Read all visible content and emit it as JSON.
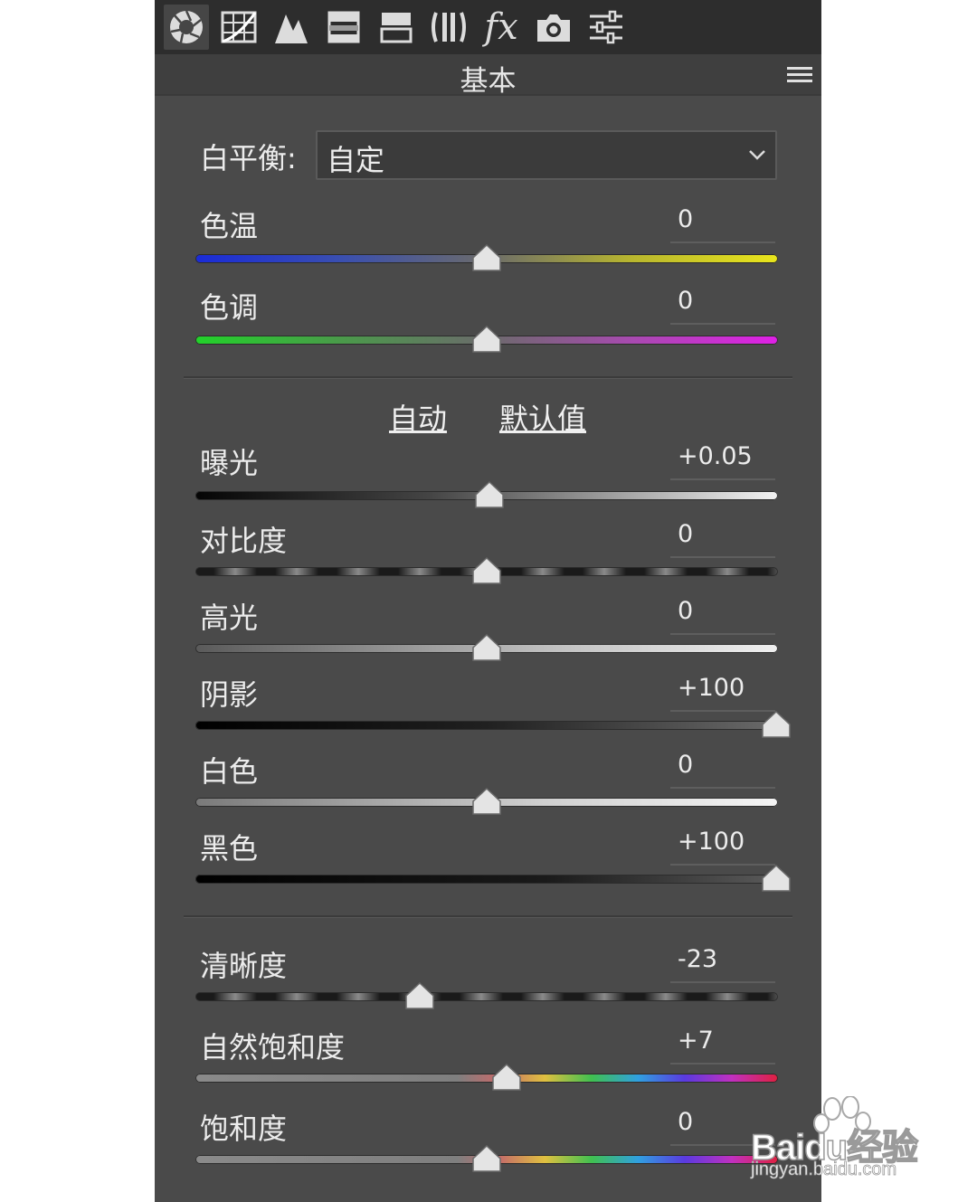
{
  "toolbar": {
    "icons": [
      "aperture-icon",
      "tone-curve-icon",
      "detail-icon",
      "hsl-icon",
      "split-toning-icon",
      "lens-corrections-icon",
      "fx-effects-icon",
      "camera-calibration-icon",
      "presets-sliders-icon"
    ],
    "fx_label": "fx"
  },
  "panel": {
    "title": "基本"
  },
  "white_balance": {
    "label": "白平衡:",
    "value": "自定"
  },
  "links": {
    "auto": "自动",
    "default": "默认值"
  },
  "sliders": [
    {
      "id": "temperature",
      "label": "色温",
      "value": "0",
      "fraction": 0.5
    },
    {
      "id": "tint",
      "label": "色调",
      "value": "0",
      "fraction": 0.5
    },
    {
      "id": "exposure",
      "label": "曝光",
      "value": "+0.05",
      "fraction": 0.505
    },
    {
      "id": "contrast",
      "label": "对比度",
      "value": "0",
      "fraction": 0.5
    },
    {
      "id": "highlights",
      "label": "高光",
      "value": "0",
      "fraction": 0.5
    },
    {
      "id": "shadows",
      "label": "阴影",
      "value": "+100",
      "fraction": 1.0
    },
    {
      "id": "whites",
      "label": "白色",
      "value": "0",
      "fraction": 0.5
    },
    {
      "id": "blacks",
      "label": "黑色",
      "value": "+100",
      "fraction": 1.0
    },
    {
      "id": "clarity",
      "label": "清晰度",
      "value": "-23",
      "fraction": 0.385
    },
    {
      "id": "vibrance",
      "label": "自然饱和度",
      "value": "+7",
      "fraction": 0.535
    },
    {
      "id": "saturation",
      "label": "饱和度",
      "value": "0",
      "fraction": 0.5
    }
  ],
  "watermark": {
    "brand": "Baidu经验",
    "url": "jingyan.baidu.com"
  },
  "colors": {
    "panel_bg": "#4a4a4a",
    "toolbar_bg": "#2d2d2d",
    "text": "#ececec"
  }
}
